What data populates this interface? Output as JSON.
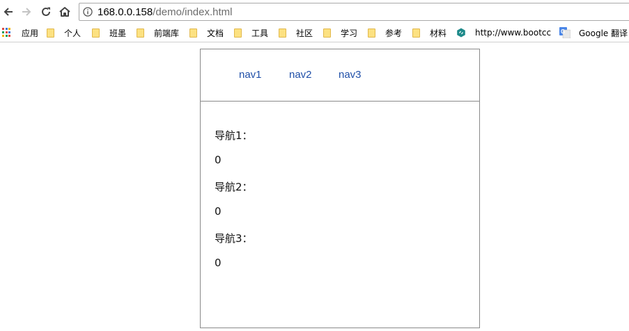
{
  "browser": {
    "url_host": "168.0.0.158",
    "url_path": "/demo/index.html"
  },
  "bookmarks": {
    "apps_label": "应用",
    "items": [
      "个人",
      "班墨",
      "前端库",
      "文档",
      "工具",
      "社区",
      "学习",
      "参考",
      "材料"
    ],
    "bootcss_label": "http://www.bootcc",
    "google_translate_label": "Google 翻译"
  },
  "page": {
    "nav": [
      "nav1",
      "nav2",
      "nav3"
    ],
    "sections": [
      {
        "label": "导航1：",
        "value": "0"
      },
      {
        "label": "导航2：",
        "value": "0"
      },
      {
        "label": "导航3：",
        "value": "0"
      }
    ]
  },
  "colors": {
    "link": "#1f4fa8",
    "border": "#8a8a8a",
    "folder": "#fce181"
  }
}
